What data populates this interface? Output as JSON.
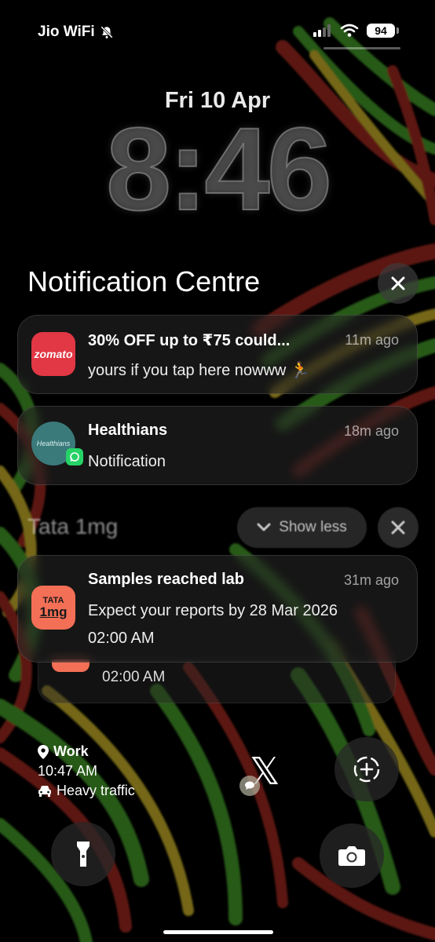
{
  "status_bar": {
    "carrier": "Jio WiFi",
    "battery": "94",
    "icons": [
      "bell-slash-icon",
      "cellular-signal-icon",
      "wifi-icon",
      "battery-icon"
    ]
  },
  "lock_screen": {
    "date": "Fri 10 Apr",
    "time": "8:46"
  },
  "notification_centre": {
    "title": "Notification Centre"
  },
  "notifications": [
    {
      "app": "zomato",
      "title": "30% OFF up to ₹75 could...",
      "time": "11m ago",
      "body": "yours if you tap here nowww 🏃"
    },
    {
      "app": "Healthians",
      "title": "Healthians",
      "time": "18m ago",
      "body": "Notification"
    }
  ],
  "group": {
    "name": "Tata 1mg",
    "show_less_label": "Show less",
    "notification": {
      "title": "Samples reached lab",
      "time": "31m ago",
      "body_line1": "Expect your reports by 28 Mar 2026",
      "body_line2": "02:00 AM",
      "icon_top": "TATA",
      "icon_bottom": "1mg"
    },
    "stacked_text": "02:00 AM"
  },
  "widget": {
    "location": "Work",
    "time": "10:47 AM",
    "traffic": "Heavy traffic"
  },
  "x_logo": "𝕏",
  "colors": {
    "zomato": "#e23744",
    "tata_1mg": "#f36f56",
    "healthians": "#3b7a7b",
    "whatsapp": "#25d366"
  }
}
